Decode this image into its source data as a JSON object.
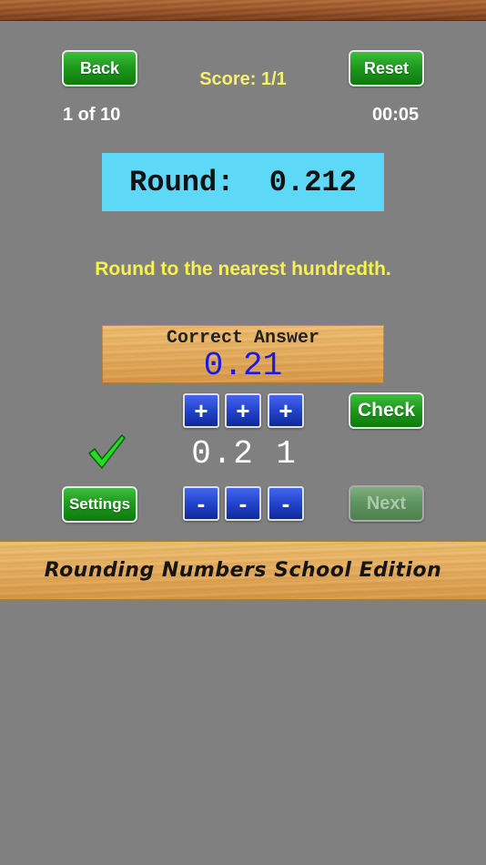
{
  "header": {
    "back_label": "Back",
    "reset_label": "Reset",
    "score": "Score: 1/1",
    "progress": "1 of 10",
    "timer": "00:05"
  },
  "problem": {
    "prompt": "Round:  0.212",
    "instruction": "Round to the nearest hundredth."
  },
  "answer": {
    "title": "Correct Answer",
    "value": "0.21"
  },
  "controls": {
    "plus_label": "+",
    "minus_label": "-",
    "check_label": "Check",
    "settings_label": "Settings",
    "next_label": "Next",
    "digits": [
      "0",
      ".",
      "2",
      "1"
    ]
  },
  "result": {
    "icon": "checkmark-icon",
    "color": "#22dd22"
  },
  "footer": {
    "title": "Rounding Numbers School Edition"
  }
}
